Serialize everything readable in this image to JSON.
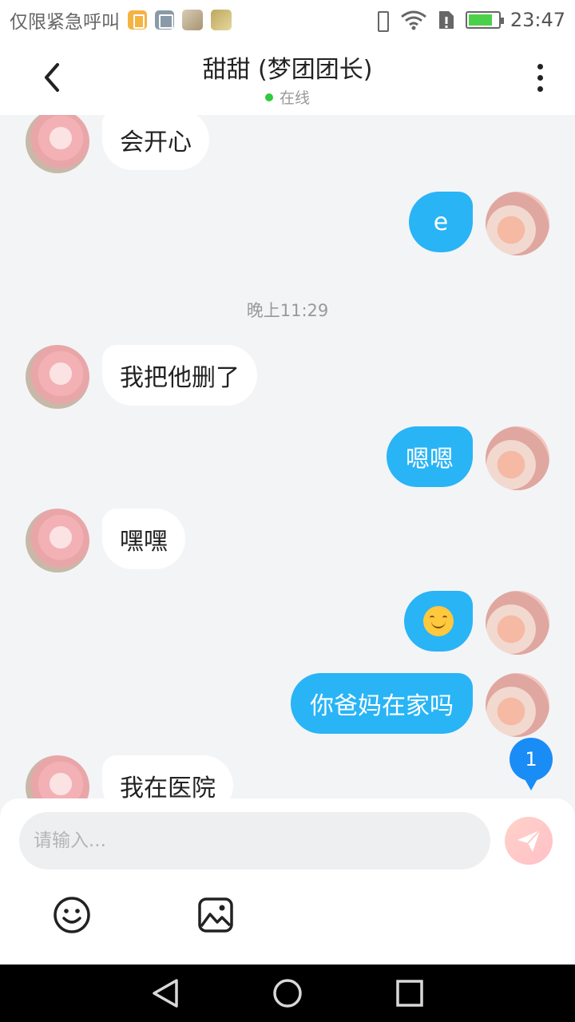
{
  "status_bar": {
    "carrier": "仅限紧急呼叫",
    "time": "23:47"
  },
  "header": {
    "title": "甜甜 (梦团团长)",
    "presence": "在线",
    "online_color": "#30c93f"
  },
  "chat": {
    "timestamp": "晚上11:29",
    "messages": [
      {
        "side": "in",
        "text": "会开心"
      },
      {
        "side": "out",
        "text": "e"
      },
      {
        "side": "in",
        "text": "我把他删了"
      },
      {
        "side": "out",
        "text": "嗯嗯"
      },
      {
        "side": "in",
        "text": "嘿嘿"
      },
      {
        "side": "out",
        "text": "",
        "emoji": "smiling-face-emoji"
      },
      {
        "side": "out",
        "text": "你爸妈在家吗"
      },
      {
        "side": "in",
        "text": "我在医院"
      }
    ],
    "unread_count": "1"
  },
  "input": {
    "placeholder": "请输入..."
  },
  "colors": {
    "outgoing_bubble": "#29b4f6",
    "incoming_bubble": "#ffffff",
    "badge": "#1a8cf5",
    "background": "#f3f4f6"
  },
  "icons": {
    "back": "chevron-left-icon",
    "more": "more-vertical-icon",
    "send": "paper-plane-icon",
    "emoji": "emoji-icon",
    "image": "image-icon",
    "nav_back": "triangle-back-icon",
    "nav_home": "circle-home-icon",
    "nav_recent": "square-recent-icon"
  }
}
